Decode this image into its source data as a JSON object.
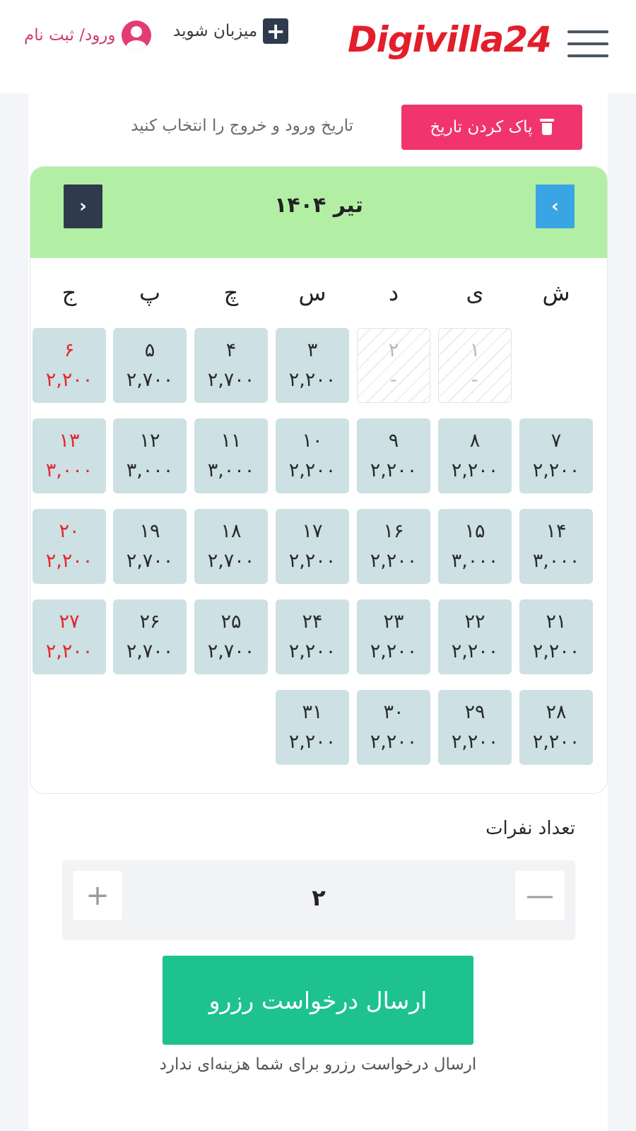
{
  "header": {
    "logo": "Digivilla24",
    "host_label": "میزبان شوید",
    "host_icon": "plus-square-icon",
    "login_label": "ورود/ ثبت نام",
    "login_icon": "user-circle-icon",
    "menu_icon": "hamburger-menu-icon"
  },
  "date_picker": {
    "clear_label": "پاک کردن تاریخ",
    "clear_icon": "trash-icon",
    "hint": "تاریخ ورود و خروج را انتخاب کنید"
  },
  "calendar": {
    "month_title": "تیر ۱۴۰۴",
    "next_icon": "chevron-right-icon",
    "prev_icon": "chevron-left-icon",
    "weekdays": [
      "ش",
      "ی",
      "د",
      "س",
      "چ",
      "پ",
      "ج"
    ],
    "days": [
      {
        "num": "۱",
        "price": "-",
        "disabled": true,
        "holiday": false
      },
      {
        "num": "۲",
        "price": "-",
        "disabled": true,
        "holiday": false
      },
      {
        "num": "۳",
        "price": "۲,۲۰۰",
        "disabled": false,
        "holiday": false
      },
      {
        "num": "۴",
        "price": "۲,۷۰۰",
        "disabled": false,
        "holiday": false
      },
      {
        "num": "۵",
        "price": "۲,۷۰۰",
        "disabled": false,
        "holiday": false
      },
      {
        "num": "۶",
        "price": "۲,۲۰۰",
        "disabled": false,
        "holiday": true
      },
      {
        "num": "۷",
        "price": "۲,۲۰۰",
        "disabled": false,
        "holiday": false
      },
      {
        "num": "۸",
        "price": "۲,۲۰۰",
        "disabled": false,
        "holiday": false
      },
      {
        "num": "۹",
        "price": "۲,۲۰۰",
        "disabled": false,
        "holiday": false
      },
      {
        "num": "۱۰",
        "price": "۲,۲۰۰",
        "disabled": false,
        "holiday": false
      },
      {
        "num": "۱۱",
        "price": "۳,۰۰۰",
        "disabled": false,
        "holiday": false
      },
      {
        "num": "۱۲",
        "price": "۳,۰۰۰",
        "disabled": false,
        "holiday": false
      },
      {
        "num": "۱۳",
        "price": "۳,۰۰۰",
        "disabled": false,
        "holiday": true
      },
      {
        "num": "۱۴",
        "price": "۳,۰۰۰",
        "disabled": false,
        "holiday": false
      },
      {
        "num": "۱۵",
        "price": "۳,۰۰۰",
        "disabled": false,
        "holiday": false
      },
      {
        "num": "۱۶",
        "price": "۲,۲۰۰",
        "disabled": false,
        "holiday": false
      },
      {
        "num": "۱۷",
        "price": "۲,۲۰۰",
        "disabled": false,
        "holiday": false
      },
      {
        "num": "۱۸",
        "price": "۲,۷۰۰",
        "disabled": false,
        "holiday": false
      },
      {
        "num": "۱۹",
        "price": "۲,۷۰۰",
        "disabled": false,
        "holiday": false
      },
      {
        "num": "۲۰",
        "price": "۲,۲۰۰",
        "disabled": false,
        "holiday": true
      },
      {
        "num": "۲۱",
        "price": "۲,۲۰۰",
        "disabled": false,
        "holiday": false
      },
      {
        "num": "۲۲",
        "price": "۲,۲۰۰",
        "disabled": false,
        "holiday": false
      },
      {
        "num": "۲۳",
        "price": "۲,۲۰۰",
        "disabled": false,
        "holiday": false
      },
      {
        "num": "۲۴",
        "price": "۲,۲۰۰",
        "disabled": false,
        "holiday": false
      },
      {
        "num": "۲۵",
        "price": "۲,۷۰۰",
        "disabled": false,
        "holiday": false
      },
      {
        "num": "۲۶",
        "price": "۲,۷۰۰",
        "disabled": false,
        "holiday": false
      },
      {
        "num": "۲۷",
        "price": "۲,۲۰۰",
        "disabled": false,
        "holiday": true
      },
      {
        "num": "۲۸",
        "price": "۲,۲۰۰",
        "disabled": false,
        "holiday": false
      },
      {
        "num": "۲۹",
        "price": "۲,۲۰۰",
        "disabled": false,
        "holiday": false
      },
      {
        "num": "۳۰",
        "price": "۲,۲۰۰",
        "disabled": false,
        "holiday": false
      },
      {
        "num": "۳۱",
        "price": "۲,۲۰۰",
        "disabled": false,
        "holiday": false
      }
    ]
  },
  "guests": {
    "label": "تعداد نفرات",
    "count": "۲",
    "plus_symbol": "+",
    "minus_symbol": "—"
  },
  "submit": {
    "label": "ارسال درخواست رزرو",
    "note": "ارسال درخواست رزرو برای شما هزینه‌ای ندارد"
  },
  "colors": {
    "accent_pink": "#f0346e",
    "header_green": "#b2efa5",
    "submit_green": "#1ec28e",
    "day_cell": "#cde0e3",
    "holiday_red": "#e3262d",
    "logo_red": "#e31e2b"
  }
}
